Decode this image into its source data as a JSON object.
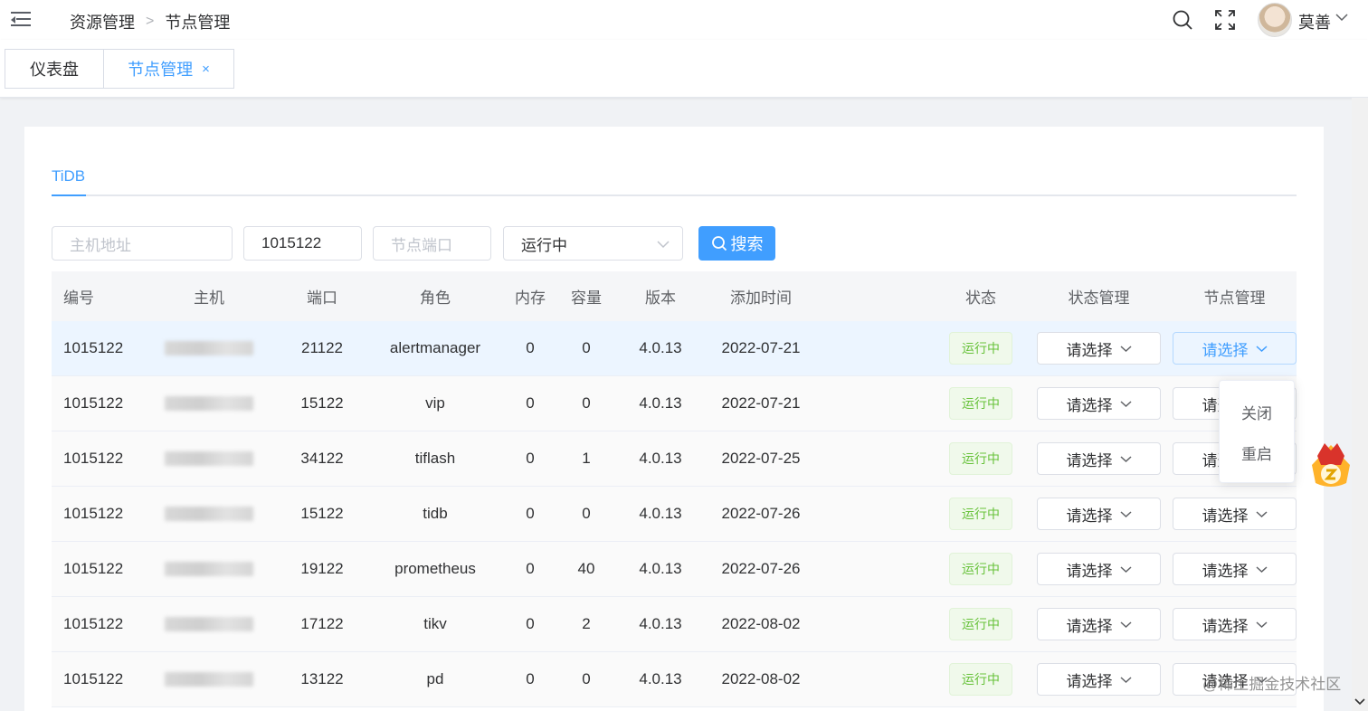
{
  "header": {
    "breadcrumb": [
      "资源管理",
      "节点管理"
    ],
    "username": "莫善"
  },
  "tabs": [
    {
      "label": "仪表盘",
      "active": false
    },
    {
      "label": "节点管理",
      "active": true,
      "close": "×"
    }
  ],
  "card": {
    "inner_tab": "TiDB",
    "filters": {
      "host_placeholder": "主机地址",
      "id_value": "1015122",
      "port_placeholder": "节点端口",
      "status_value": "运行中",
      "search_label": "搜索"
    },
    "table": {
      "headers": [
        "编号",
        "主机",
        "端口",
        "角色",
        "内存",
        "容量",
        "版本",
        "添加时间",
        "状态",
        "状态管理",
        "节点管理"
      ],
      "rows": [
        {
          "id": "1015122",
          "port": "21122",
          "role": "alertmanager",
          "mem": "0",
          "cap": "0",
          "ver": "4.0.13",
          "date": "2022-07-21",
          "status": "运行中",
          "state_mgmt": "请选择",
          "node_mgmt": "请选择"
        },
        {
          "id": "1015122",
          "port": "15122",
          "role": "vip",
          "mem": "0",
          "cap": "0",
          "ver": "4.0.13",
          "date": "2022-07-21",
          "status": "运行中",
          "state_mgmt": "请选择",
          "node_mgmt": "请选择"
        },
        {
          "id": "1015122",
          "port": "34122",
          "role": "tiflash",
          "mem": "0",
          "cap": "1",
          "ver": "4.0.13",
          "date": "2022-07-25",
          "status": "运行中",
          "state_mgmt": "请选择",
          "node_mgmt": "请选择"
        },
        {
          "id": "1015122",
          "port": "15122",
          "role": "tidb",
          "mem": "0",
          "cap": "0",
          "ver": "4.0.13",
          "date": "2022-07-26",
          "status": "运行中",
          "state_mgmt": "请选择",
          "node_mgmt": "请选择"
        },
        {
          "id": "1015122",
          "port": "19122",
          "role": "prometheus",
          "mem": "0",
          "cap": "40",
          "ver": "4.0.13",
          "date": "2022-07-26",
          "status": "运行中",
          "state_mgmt": "请选择",
          "node_mgmt": "请选择"
        },
        {
          "id": "1015122",
          "port": "17122",
          "role": "tikv",
          "mem": "0",
          "cap": "2",
          "ver": "4.0.13",
          "date": "2022-08-02",
          "status": "运行中",
          "state_mgmt": "请选择",
          "node_mgmt": "请选择"
        },
        {
          "id": "1015122",
          "port": "13122",
          "role": "pd",
          "mem": "0",
          "cap": "0",
          "ver": "4.0.13",
          "date": "2022-08-02",
          "status": "运行中",
          "state_mgmt": "请选择",
          "node_mgmt": "请选择"
        }
      ]
    }
  },
  "dropdown": {
    "items": [
      "关闭",
      "重启"
    ]
  },
  "watermark": "@稀土掘金技术社区",
  "colors": {
    "primary": "#409eff",
    "success": "#67c23a",
    "bg": "#f0f2f5"
  }
}
